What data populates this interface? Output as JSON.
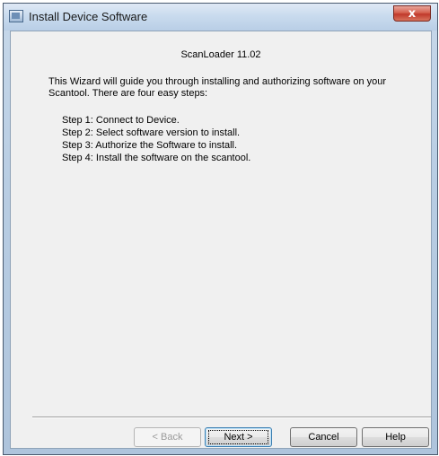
{
  "window": {
    "title": "Install Device Software",
    "close_glyph": "x",
    "icon": "window-app-icon"
  },
  "content": {
    "heading": "ScanLoader 11.02",
    "intro": "This Wizard will guide you through installing and authorizing software on your Scantool.  There are four easy steps:",
    "steps": [
      "Step 1:  Connect to Device.",
      "Step 2:  Select software version to install.",
      "Step 3:  Authorize the Software to install.",
      "Step 4:  Install the software on the scantool."
    ]
  },
  "buttons": {
    "back": "< Back",
    "next": "Next >",
    "cancel": "Cancel",
    "help": "Help"
  },
  "colors": {
    "title_bar": "#c9dbee",
    "close_button": "#c0392b",
    "client_bg": "#f0f0f0"
  }
}
